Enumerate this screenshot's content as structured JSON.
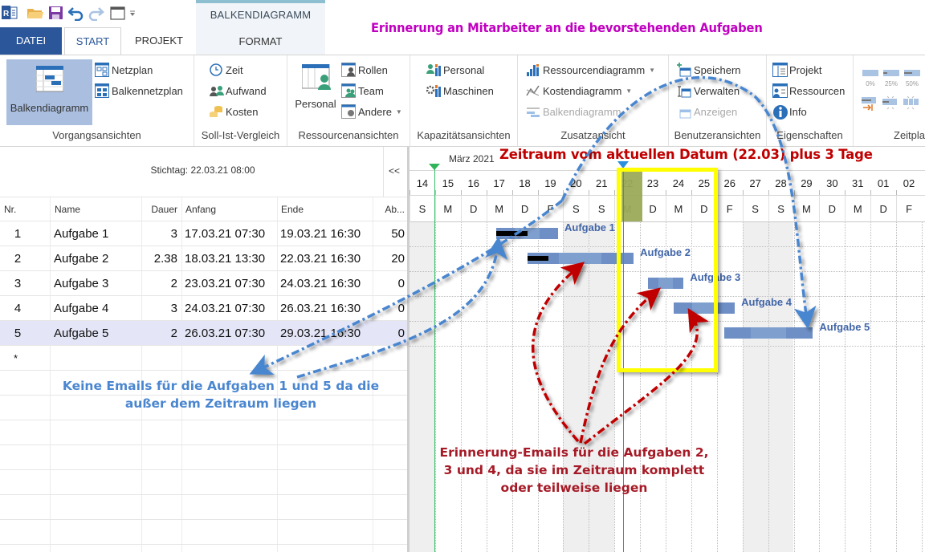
{
  "quick_access": {
    "icons": [
      "app-icon",
      "open-folder-icon",
      "save-icon",
      "undo-icon",
      "redo-icon",
      "window-icon",
      "customize-dropdown-icon"
    ]
  },
  "context_tab": {
    "title": "BALKENDIAGRAMM",
    "format": "FORMAT"
  },
  "tabs": [
    {
      "label": "DATEI"
    },
    {
      "label": "START"
    },
    {
      "label": "PROJEKT"
    }
  ],
  "annotations": {
    "headline": "Erinnerung an Mitarbeiter an die bevorstehenden Aufgaben",
    "period": "Zeitraum vom aktuellen Datum (22.03) plus 3 Tage",
    "no_emails": "Keine Emails für die Aufgaben 1 und 5 da die außer dem Zeitraum liegen",
    "reminder_emails": "Erinnerung-Emails für die Aufgaben 2, 3 und 4, da sie im Zeitraum komplett oder teilweise liegen"
  },
  "ribbon": {
    "vorgangsansichten": {
      "label": "Vorgangsansichten",
      "balkendiagramm": "Balkendiagramm",
      "netzplan": "Netzplan",
      "balkennetzplan": "Balkennetzplan"
    },
    "soll_ist": {
      "label": "Soll-Ist-Vergleich",
      "zeit": "Zeit",
      "aufwand": "Aufwand",
      "kosten": "Kosten"
    },
    "ressourcenansichten": {
      "label": "Ressourcenansichten",
      "personal": "Personal",
      "rollen": "Rollen",
      "team": "Team",
      "andere": "Andere"
    },
    "kapazitaet": {
      "label": "Kapazitätsansichten",
      "personal": "Personal",
      "maschinen": "Maschinen"
    },
    "zusatz": {
      "label": "Zusatzansicht",
      "ressourcendiagramm": "Ressourcendiagramm",
      "kostendiagramm": "Kostendiagramm",
      "balkendiagramm": "Balkendiagramm"
    },
    "benutzer": {
      "label": "Benutzeransichten",
      "speichern": "Speichern",
      "verwalten": "Verwalten",
      "anzeigen": "Anzeigen"
    },
    "eigenschaften": {
      "label": "Eigenschaften",
      "projekt": "Projekt",
      "ressourcen": "Ressourcen",
      "info": "Info"
    },
    "zeitplan": {
      "label": "Zeitpla",
      "p0": "0%",
      "p25": "25%",
      "p50": "50%"
    }
  },
  "table": {
    "stichtag": "Stichtag: 22.03.21 08:00",
    "collapse": "<<",
    "headers": {
      "nr": "Nr.",
      "name": "Name",
      "dauer": "Dauer",
      "anfang": "Anfang",
      "ende": "Ende",
      "ab": "Ab..."
    },
    "rows": [
      {
        "nr": "1",
        "name": "Aufgabe 1",
        "dauer": "3",
        "anfang": "17.03.21 07:30",
        "ende": "19.03.21 16:30",
        "ab": "50"
      },
      {
        "nr": "2",
        "name": "Aufgabe 2",
        "dauer": "2.38",
        "anfang": "18.03.21 13:30",
        "ende": "22.03.21 16:30",
        "ab": "20"
      },
      {
        "nr": "3",
        "name": "Aufgabe 3",
        "dauer": "2",
        "anfang": "23.03.21 07:30",
        "ende": "24.03.21 16:30",
        "ab": "0"
      },
      {
        "nr": "4",
        "name": "Aufgabe 4",
        "dauer": "3",
        "anfang": "24.03.21 07:30",
        "ende": "26.03.21 16:30",
        "ab": "0"
      },
      {
        "nr": "5",
        "name": "Aufgabe 5",
        "dauer": "2",
        "anfang": "26.03.21 07:30",
        "ende": "29.03.21 16:30",
        "ab": "0"
      }
    ],
    "new_row_marker": "*",
    "selected_row": 5
  },
  "gantt": {
    "month": "März 2021",
    "days": [
      "14",
      "15",
      "16",
      "17",
      "18",
      "19",
      "20",
      "21",
      "22",
      "23",
      "24",
      "25",
      "26",
      "27",
      "28",
      "29",
      "30",
      "31",
      "01",
      "02"
    ],
    "weekdays": [
      "S",
      "M",
      "D",
      "M",
      "D",
      "F",
      "S",
      "S",
      "M",
      "D",
      "M",
      "D",
      "F",
      "S",
      "S",
      "M",
      "D",
      "M",
      "D",
      "F"
    ],
    "weekend_indices": [
      0,
      6,
      7,
      13,
      14
    ],
    "today_index": 8,
    "period_days": [
      8,
      11
    ],
    "bars": [
      {
        "label": "Aufgabe 1",
        "start": 3.4,
        "end": 5.8,
        "progress": 0.5
      },
      {
        "label": "Aufgabe 2",
        "start": 4.6,
        "end": 8.75,
        "progress": 0.2
      },
      {
        "label": "Aufgabe 3",
        "start": 9.3,
        "end": 10.7,
        "progress": 0
      },
      {
        "label": "Aufgabe 4",
        "start": 10.3,
        "end": 12.7,
        "progress": 0
      },
      {
        "label": "Aufgabe 5",
        "start": 12.3,
        "end": 15.75,
        "progress": 0
      }
    ]
  }
}
